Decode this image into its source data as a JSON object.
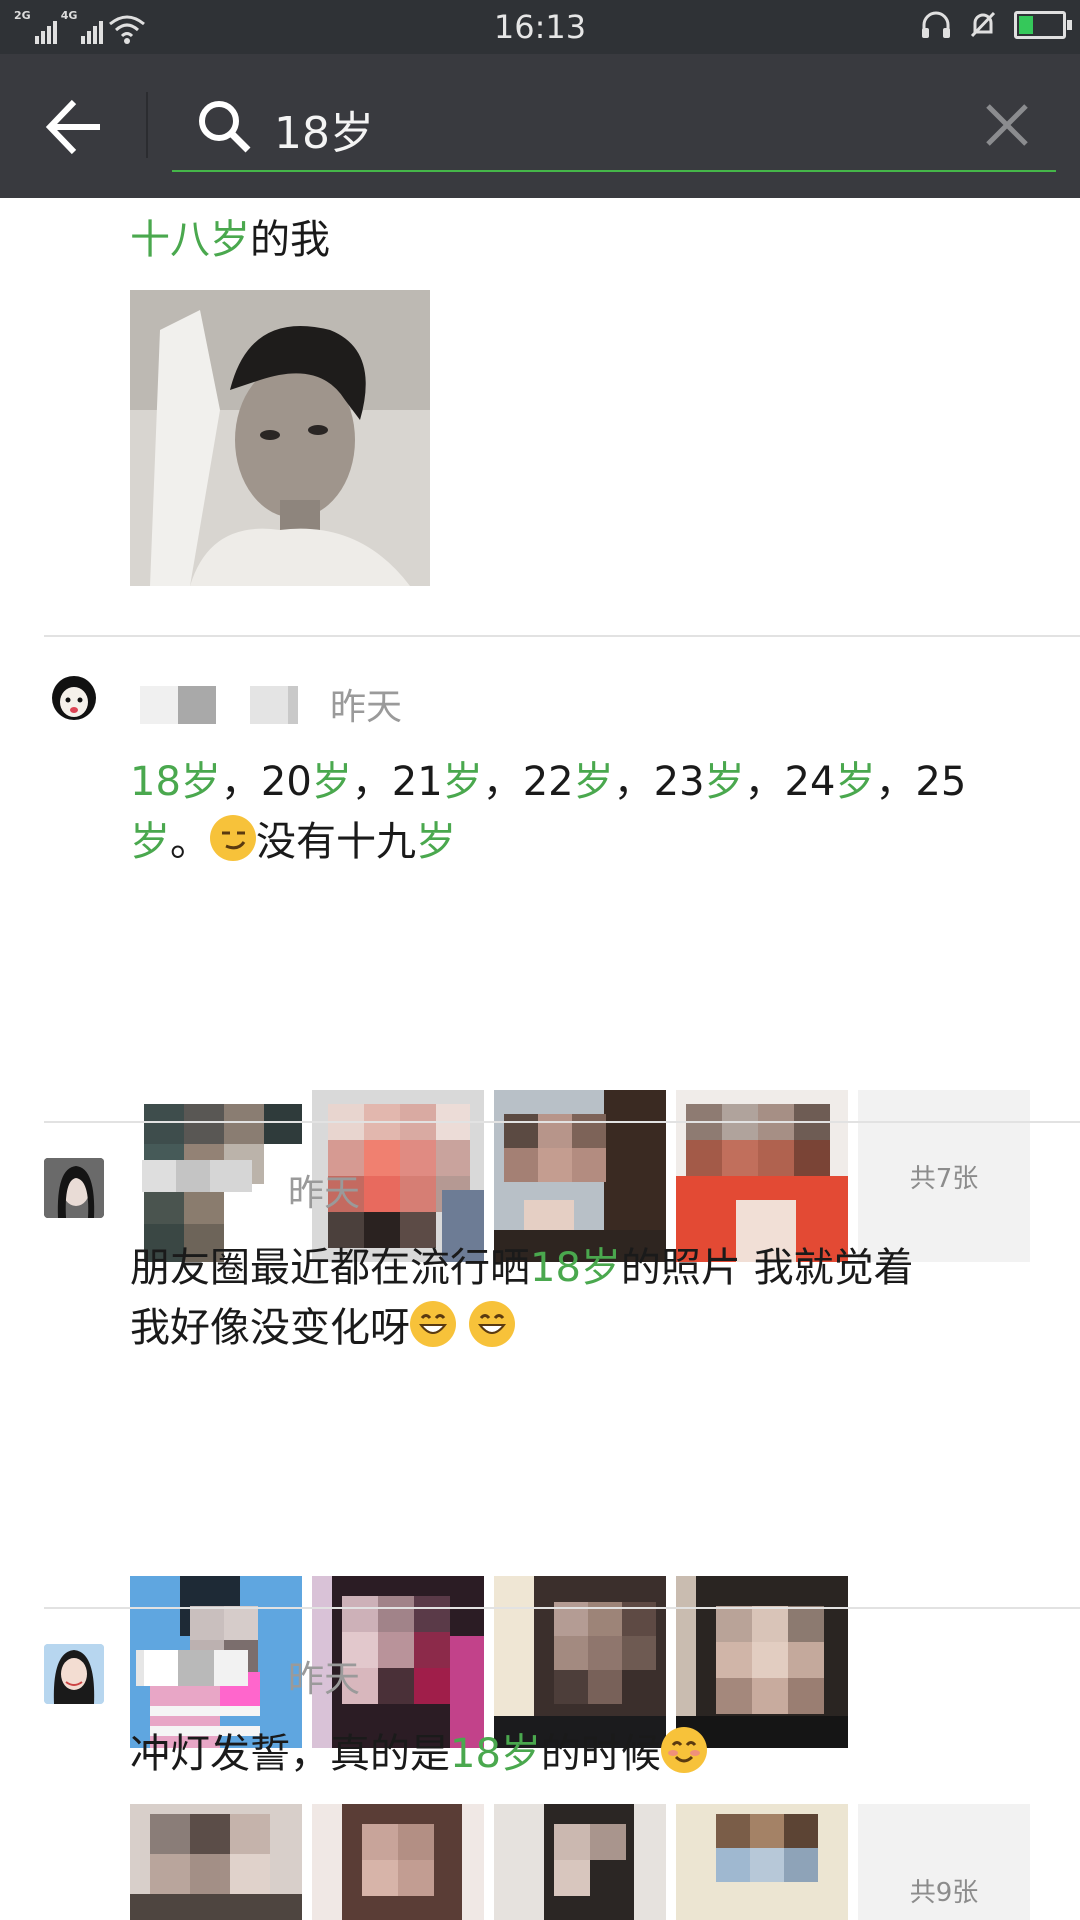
{
  "status": {
    "network_1": "2G",
    "network_2": "4G",
    "time": "16:13"
  },
  "search": {
    "query": "18岁"
  },
  "post1": {
    "text_hl": "十八岁",
    "text_rest": "的我"
  },
  "post2": {
    "time": "昨天",
    "segs": [
      "18",
      "岁",
      "，20",
      "岁",
      "，21",
      "岁",
      "，22",
      "岁",
      "，23",
      "岁",
      "，24",
      "岁",
      "，25"
    ],
    "line2_hl": "岁",
    "line2_rest": "。",
    "line2_end": "没有十九",
    "line2_end_hl": "岁",
    "more": "共7张"
  },
  "post3": {
    "time": "昨天",
    "text_a": "朋友圈最近都在流行晒",
    "text_hl": "18岁",
    "text_b": "的照片 我就觉着",
    "text_c": "我好像没变化呀"
  },
  "post4": {
    "time": "昨天",
    "text_a": "冲灯发誓，真的是",
    "text_hl": "18岁",
    "text_b": "的时候",
    "more": "共9张"
  }
}
